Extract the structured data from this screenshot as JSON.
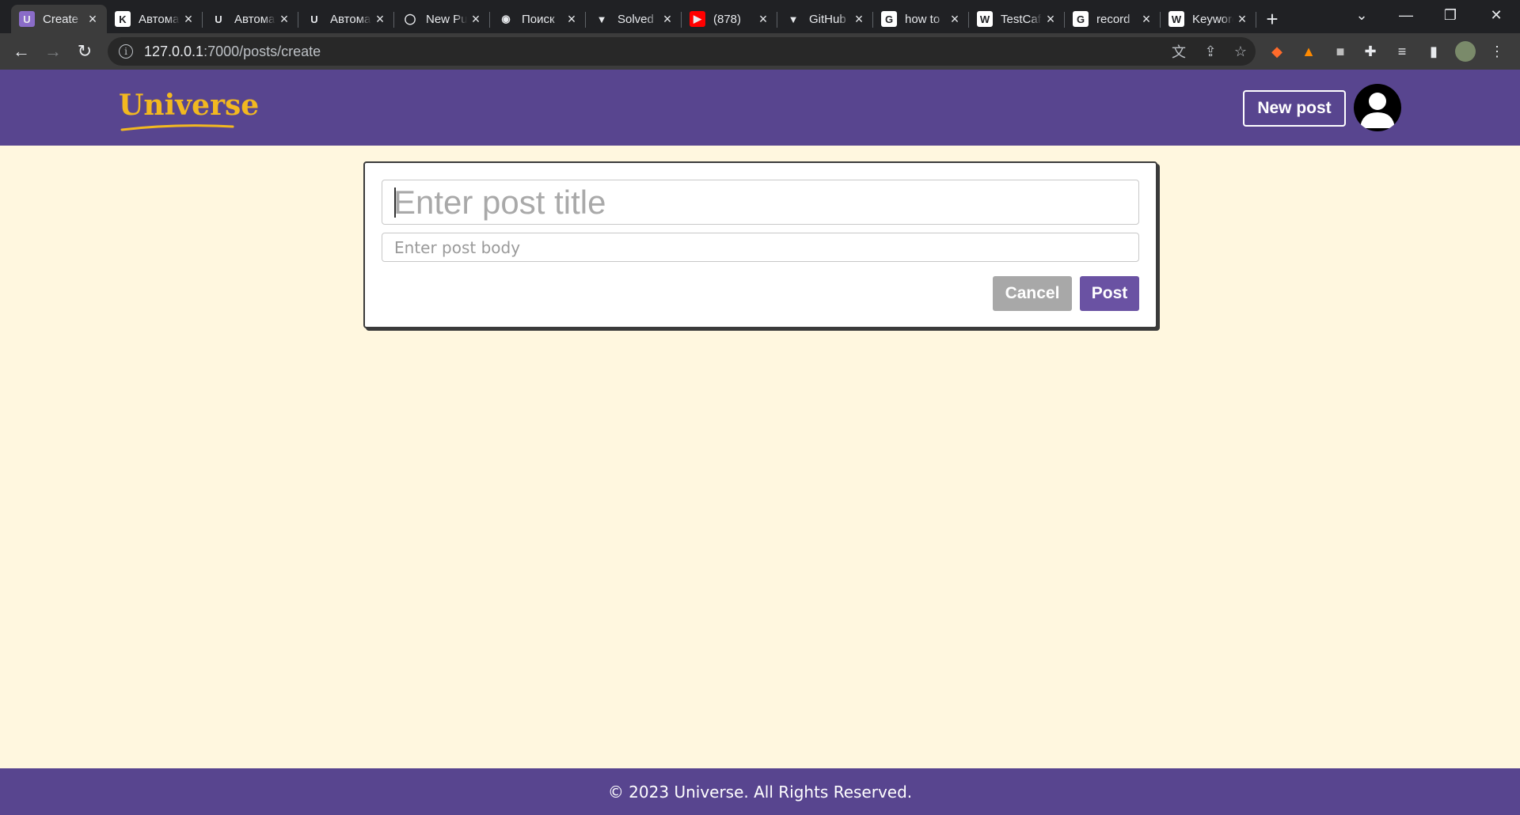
{
  "browser": {
    "tabs": [
      {
        "title": "Create",
        "favicon": "U",
        "favicon_bg": "#8a6cc8",
        "active": true
      },
      {
        "title": "Автоматизация",
        "favicon": "K",
        "favicon_bg": "#ffffff"
      },
      {
        "title": "Автоматизация",
        "favicon": "U",
        "favicon_bg": "#202124"
      },
      {
        "title": "Автоматизация",
        "favicon": "U",
        "favicon_bg": "#202124"
      },
      {
        "title": "New Pull Request",
        "favicon": "◯",
        "favicon_bg": "#202124"
      },
      {
        "title": "Поиск",
        "favicon": "◉",
        "favicon_bg": "#202124"
      },
      {
        "title": "Solved",
        "favicon": "▼",
        "favicon_bg": "#202124"
      },
      {
        "title": "(878)",
        "favicon": "▶",
        "favicon_bg": "#ff0000"
      },
      {
        "title": "GitHub",
        "favicon": "▼",
        "favicon_bg": "#202124"
      },
      {
        "title": "how to",
        "favicon": "G",
        "favicon_bg": "#ffffff"
      },
      {
        "title": "TestCafe",
        "favicon": "W",
        "favicon_bg": "#ffffff"
      },
      {
        "title": "record",
        "favicon": "G",
        "favicon_bg": "#ffffff"
      },
      {
        "title": "Keywords",
        "favicon": "W",
        "favicon_bg": "#ffffff"
      }
    ],
    "new_tab": "+",
    "url_host": "127.0.0.1",
    "url_rest": ":7000/posts/create"
  },
  "header": {
    "logo_text": "Universe",
    "new_post_label": "New post"
  },
  "form": {
    "title_placeholder": "Enter post title",
    "body_placeholder": "Enter post body",
    "cancel_label": "Cancel",
    "post_label": "Post"
  },
  "footer": {
    "text": "© 2023 Universe. All Rights Reserved."
  },
  "colors": {
    "brand_purple": "#58458f",
    "button_purple": "#6a52a3",
    "logo_gold": "#f2b820",
    "page_bg": "#fff7df"
  }
}
